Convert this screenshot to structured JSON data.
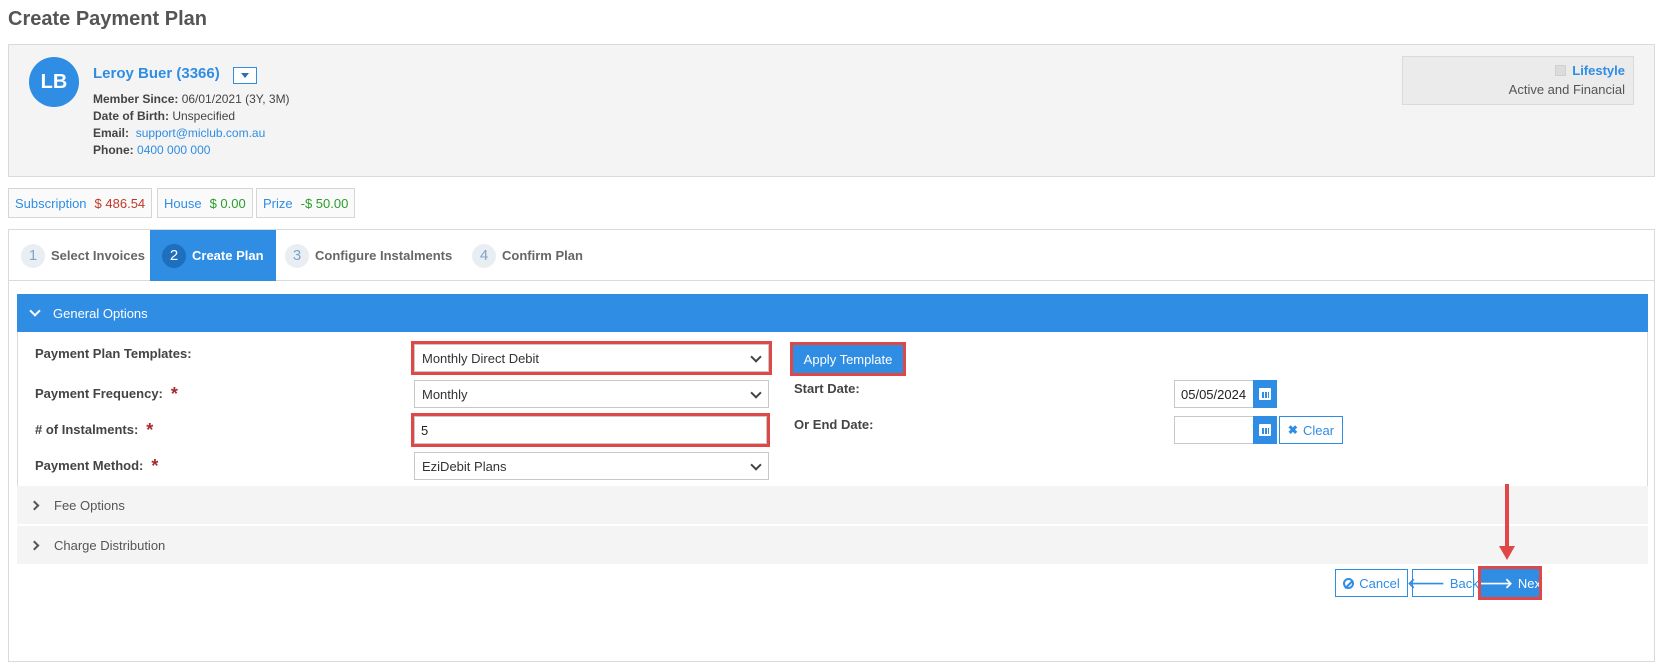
{
  "page": {
    "title": "Create Payment Plan"
  },
  "member": {
    "initials": "LB",
    "name": "Leroy Buer (3366)",
    "member_since_label": "Member Since:",
    "member_since_value": "06/01/2021 (3Y, 3M)",
    "dob_label": "Date of Birth:",
    "dob_value": "Unspecified",
    "email_label": "Email:",
    "email_value": "support@miclub.com.au",
    "phone_label": "Phone:",
    "phone_value": "0400 000 000",
    "tier_name": "Lifestyle",
    "tier_status": "Active and Financial"
  },
  "balances": [
    {
      "label": "Subscription",
      "value": "$ 486.54",
      "color": "#c0392b"
    },
    {
      "label": "House",
      "value": "$ 0.00",
      "color": "#2a9d2a"
    },
    {
      "label": "Prize",
      "value": "-$ 50.00",
      "color": "#2a9d2a"
    }
  ],
  "steps": [
    {
      "num": "1",
      "label": "Select Invoices"
    },
    {
      "num": "2",
      "label": "Create Plan",
      "active": true
    },
    {
      "num": "3",
      "label": "Configure Instalments"
    },
    {
      "num": "4",
      "label": "Confirm Plan"
    }
  ],
  "general": {
    "header": "General Options",
    "template_label": "Payment Plan Templates:",
    "template_value": "Monthly Direct Debit",
    "apply_template": "Apply Template",
    "frequency_label": "Payment Frequency:",
    "frequency_value": "Monthly",
    "instalments_label": "# of Instalments:",
    "instalments_value": "5",
    "method_label": "Payment Method:",
    "method_value": "EziDebit Plans",
    "required_mark": "*",
    "start_date_label": "Start Date:",
    "start_date_value": "05/05/2024",
    "end_date_label": "Or End Date:",
    "end_date_value": "",
    "clear_label": "Clear"
  },
  "sections": {
    "fee_options": "Fee Options",
    "charge_distribution": "Charge Distribution"
  },
  "footer": {
    "cancel": "Cancel",
    "back": "Back",
    "next": "Next"
  },
  "colors": {
    "accent": "#2f8de4",
    "highlight": "#e04848"
  }
}
